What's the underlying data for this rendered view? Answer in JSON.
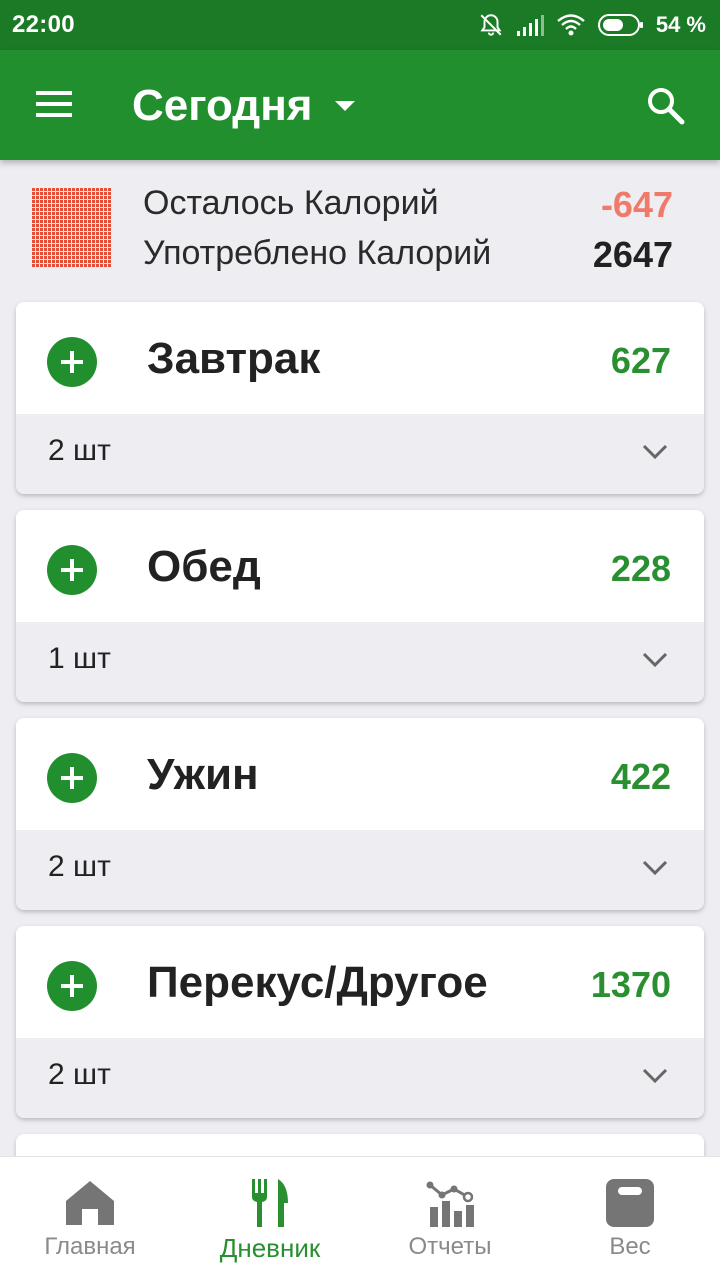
{
  "status_bar": {
    "time": "22:00",
    "battery_percent": "54 %",
    "icons": [
      "bell-off-icon",
      "signal-icon",
      "wifi-icon",
      "battery-icon"
    ]
  },
  "app_bar": {
    "title": "Сегодня",
    "icons": [
      "menu-icon",
      "dropdown-arrow-icon",
      "search-icon"
    ]
  },
  "summary": {
    "remaining_label": "Осталось Калорий",
    "remaining_value": "-647",
    "consumed_label": "Употреблено Калорий",
    "consumed_value": "2647",
    "colors": {
      "remaining": "#f07a6a",
      "consumed": "#212121",
      "grid": "#e44f3a"
    }
  },
  "meals": [
    {
      "name": "Завтрак",
      "calories": "627",
      "count": "2 шт"
    },
    {
      "name": "Обед",
      "calories": "228",
      "count": "1 шт"
    },
    {
      "name": "Ужин",
      "calories": "422",
      "count": "2 шт"
    },
    {
      "name": "Перекус/Другое",
      "calories": "1370",
      "count": "2 шт"
    }
  ],
  "bottom_nav": {
    "items": [
      {
        "label": "Главная",
        "icon": "home-icon",
        "active": false
      },
      {
        "label": "Дневник",
        "icon": "fork-knife-icon",
        "active": true
      },
      {
        "label": "Отчеты",
        "icon": "chart-icon",
        "active": false
      },
      {
        "label": "Вес",
        "icon": "scale-icon",
        "active": false
      }
    ]
  },
  "colors": {
    "primary": "#228f2e",
    "primary_dark": "#1b7a26",
    "calorie_green": "#2a8f30",
    "background": "#eeedf1"
  }
}
